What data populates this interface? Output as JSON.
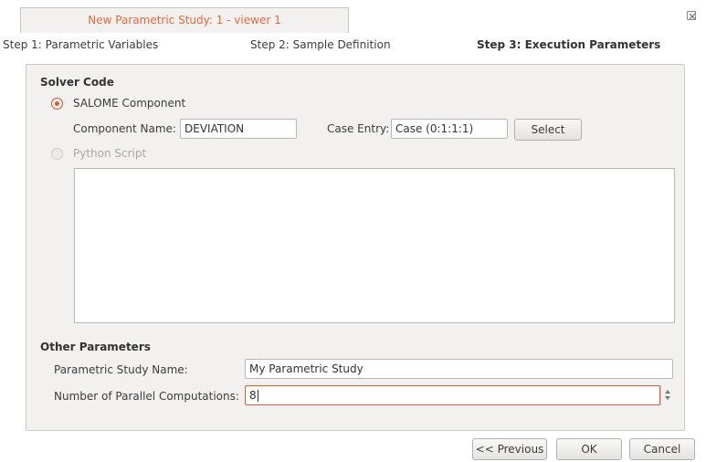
{
  "window": {
    "tab_title": "New Parametric Study: 1 - viewer 1"
  },
  "steps": {
    "step1": "Step 1: Parametric Variables",
    "step2": "Step 2: Sample Definition",
    "step3": "Step 3: Execution Parameters"
  },
  "solver_code": {
    "title": "Solver Code",
    "salome_component_label": "SALOME Component",
    "salome_component_selected": true,
    "component_name_label": "Component Name:",
    "component_name_value": "DEVIATION",
    "case_entry_label": "Case Entry:",
    "case_entry_value": "Case (0:1:1:1)",
    "select_button": "Select",
    "python_script_label": "Python Script",
    "python_script_enabled": false,
    "script_text": ""
  },
  "other_parameters": {
    "title": "Other Parameters",
    "study_name_label": "Parametric Study Name:",
    "study_name_value": "My Parametric Study",
    "parallel_label": "Number of Parallel Computations:",
    "parallel_value": "8"
  },
  "footer": {
    "previous_button": "<< Previous",
    "ok_button": "OK",
    "cancel_button": "Cancel"
  },
  "colors": {
    "accent": "#e0592e",
    "tab_text": "#e4693a",
    "panel_bg": "#f2f1ef"
  }
}
